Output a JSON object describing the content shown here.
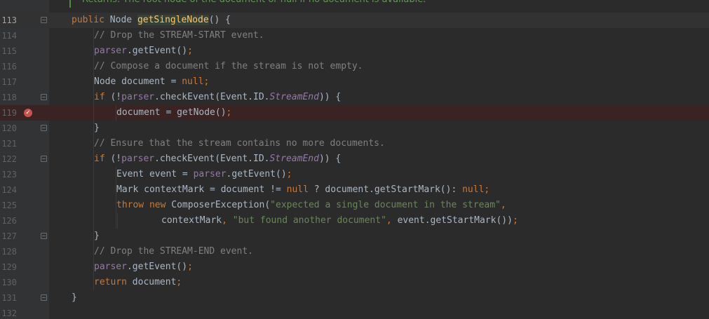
{
  "doc_comment": "Returns: The root node of the document or null if no document is available.",
  "lines": [
    {
      "num": "113",
      "tokens": [
        [
          "kw",
          "public "
        ],
        [
          "",
          "Node "
        ],
        [
          "fn-hl",
          "getSingleNode"
        ],
        [
          "",
          "() {"
        ]
      ]
    },
    {
      "num": "114",
      "tokens": [
        [
          "cm",
          "// Drop the STREAM-START event."
        ]
      ]
    },
    {
      "num": "115",
      "tokens": [
        [
          "fld",
          "parser"
        ],
        [
          "",
          ".getEvent()"
        ],
        [
          "kw",
          ";"
        ]
      ]
    },
    {
      "num": "116",
      "tokens": [
        [
          "cm",
          "// Compose a document if the stream is not empty."
        ]
      ]
    },
    {
      "num": "117",
      "tokens": [
        [
          "",
          "Node document = "
        ],
        [
          "kw",
          "null;"
        ]
      ]
    },
    {
      "num": "118",
      "tokens": [
        [
          "kw",
          "if "
        ],
        [
          "",
          "(!"
        ],
        [
          "fld",
          "parser"
        ],
        [
          "",
          ".checkEvent(Event.ID."
        ],
        [
          "it",
          "StreamEnd"
        ],
        [
          "",
          "))"
        ],
        [
          "",
          " {"
        ]
      ]
    },
    {
      "num": "119",
      "tokens": [
        [
          "",
          "document = getNode()"
        ],
        [
          "kw",
          ";"
        ]
      ]
    },
    {
      "num": "120",
      "tokens": [
        [
          "",
          "}"
        ]
      ]
    },
    {
      "num": "121",
      "tokens": [
        [
          "cm",
          "// Ensure that the stream contains no more documents."
        ]
      ]
    },
    {
      "num": "122",
      "tokens": [
        [
          "kw",
          "if "
        ],
        [
          "",
          "(!"
        ],
        [
          "fld",
          "parser"
        ],
        [
          "",
          ".checkEvent(Event.ID."
        ],
        [
          "it",
          "StreamEnd"
        ],
        [
          "",
          "))"
        ],
        [
          "",
          " {"
        ]
      ]
    },
    {
      "num": "123",
      "tokens": [
        [
          "",
          "Event event = "
        ],
        [
          "fld",
          "parser"
        ],
        [
          "",
          ".getEvent()"
        ],
        [
          "kw",
          ";"
        ]
      ]
    },
    {
      "num": "124",
      "tokens": [
        [
          "",
          "Mark contextMark = document != "
        ],
        [
          "kw",
          "null "
        ],
        [
          "",
          "? document.getStartMark(): "
        ],
        [
          "kw",
          "null;"
        ]
      ]
    },
    {
      "num": "125",
      "tokens": [
        [
          "kw",
          "throw new "
        ],
        [
          "",
          "ComposerException("
        ],
        [
          "str",
          "\"expected a single document in the stream\""
        ],
        [
          "kw",
          ","
        ]
      ]
    },
    {
      "num": "126",
      "tokens": [
        [
          "",
          "contextMark"
        ],
        [
          "kw",
          ", "
        ],
        [
          "str",
          "\"but found another document\""
        ],
        [
          "kw",
          ", "
        ],
        [
          "",
          "event.getStartMark())"
        ],
        [
          "kw",
          ";"
        ]
      ]
    },
    {
      "num": "127",
      "tokens": [
        [
          "",
          "}"
        ]
      ]
    },
    {
      "num": "128",
      "tokens": [
        [
          "cm",
          "// Drop the STREAM-END event."
        ]
      ]
    },
    {
      "num": "129",
      "tokens": [
        [
          "fld",
          "parser"
        ],
        [
          "",
          ".getEvent()"
        ],
        [
          "kw",
          ";"
        ]
      ]
    },
    {
      "num": "130",
      "tokens": [
        [
          "kw",
          "return "
        ],
        [
          "",
          "document"
        ],
        [
          "kw",
          ";"
        ]
      ]
    },
    {
      "num": "131",
      "tokens": [
        [
          "",
          "}"
        ]
      ]
    },
    {
      "num": "132",
      "tokens": []
    }
  ],
  "breakpoint_line": "119",
  "current_line": "113",
  "icons": {
    "breakpoint": "breakpoint-icon",
    "fold": "fold-marker-icon"
  }
}
